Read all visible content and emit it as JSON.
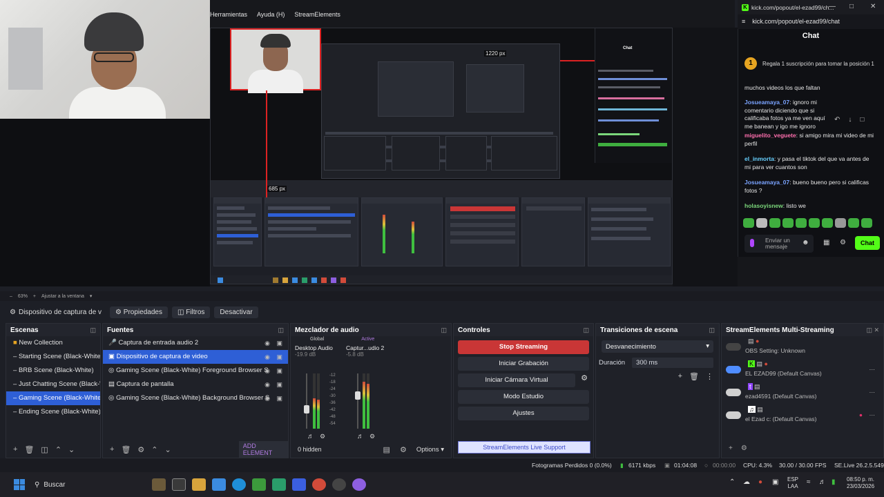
{
  "menu": [
    "Herramientas",
    "Ayuda (H)",
    "StreamElements"
  ],
  "preview_overlay": {
    "px_top": "1220 px",
    "px_left": "685 px"
  },
  "chat_window": {
    "title": "kick.com/popout/el-ezad99/ch...",
    "url": "kick.com/popout/el-ezad99/chat",
    "heading": "Chat",
    "banner": "Regala 1 suscripción para tomar la posición 1",
    "banner_badge": "1",
    "messages": [
      {
        "user": "",
        "text": "muchos videos los que faltan",
        "color": "#e6e6e6"
      },
      {
        "user": "Josueamaya_07",
        "text": ": ignoro mi comentario diciendo que si calificaba fotos ya me ven aquí me banean y igo me ignoro",
        "color": "#7aa3ff"
      },
      {
        "user": "miguelito_veguete",
        "text": ": si amigo mira mi video de mi perfil",
        "color": "#ff6fae"
      },
      {
        "user": "el_inmorta",
        "text": ": y pasa el tiktok del que va antes de mi para ver cuantos son",
        "color": "#67d0ff"
      },
      {
        "user": "Josueamaya_07",
        "text": ": bueno bueno pero si calificas fotos ?",
        "color": "#7aa3ff"
      },
      {
        "user": "holasoyisnew",
        "text": ": listo we",
        "color": "#7bd77b"
      }
    ],
    "input_placeholder": "Enviar un mensaje",
    "send_label": "Chat"
  },
  "zoom": {
    "level": "63%",
    "fit_label": "Ajustar a la ventana"
  },
  "source_toolbar": {
    "selected_source": "Dispositivo de captura de v",
    "properties": "Propiedades",
    "filters": "Filtros",
    "deactivate": "Desactivar"
  },
  "docks": {
    "scenes": {
      "title": "Escenas",
      "items": [
        "New Collection",
        "Starting Scene (Black-White)",
        "BRB Scene (Black-White)",
        "Just Chatting Scene (Black-Whit",
        "Gaming Scene (Black-White)",
        "Ending Scene (Black-White)"
      ],
      "selected_index": 4
    },
    "sources": {
      "title": "Fuentes",
      "items": [
        "Captura de entrada audio 2",
        "Dispositivo de captura de video",
        "Gaming Scene (Black-White) Foreground Browser S",
        "Captura de pantalla",
        "Gaming Scene (Black-White) Background Browser S"
      ],
      "selected_index": 1,
      "add_element": "ADD ELEMENT"
    },
    "mixer": {
      "title": "Mezclador de audio",
      "tab_global": "Global",
      "tab_active": "Active",
      "channels": [
        {
          "name": "Desktop Audio",
          "db": "-19.9 dB",
          "level": 0.55,
          "fader": 0.35
        },
        {
          "name": "Captur...udio 2",
          "db": "-5.8 dB",
          "level": 0.85,
          "fader": 0.6
        }
      ],
      "scale": [
        "-12",
        "-18",
        "-24",
        "-30",
        "-36",
        "-42",
        "-48",
        "-54"
      ],
      "hidden": "0 hidden",
      "options": "Options"
    },
    "controls": {
      "title": "Controles",
      "buttons": [
        "Stop Streaming",
        "Iniciar Grabación",
        "Iniciar Cámara Virtual",
        "Modo Estudio",
        "Ajustes"
      ],
      "se_support": "StreamElements Live Support"
    },
    "transitions": {
      "title": "Transiciones de escena",
      "selected": "Desvanecimiento",
      "duration_label": "Duración",
      "duration_value": "300 ms"
    },
    "multistream": {
      "title": "StreamElements Multi-Streaming",
      "rows": [
        {
          "label": "OBS Setting: Unknown",
          "on": false
        },
        {
          "label": "EL EZAD99 (Default Canvas)",
          "on": true
        },
        {
          "label": "ezad4591 (Default Canvas)",
          "on": false
        },
        {
          "label": "el Ezad c: (Default Canvas)",
          "on": false
        }
      ]
    }
  },
  "status": {
    "dropped": "Fotogramas Perdidos 0 (0.0%)",
    "kbps": "6171 kbps",
    "stream_time": "01:04:08",
    "rec_time": "00:00:00",
    "cpu": "CPU: 4.3%",
    "fps": "30.00 / 30.00 FPS",
    "version": "SE.Live 26.2.5.549"
  },
  "taskbar": {
    "search": "Buscar",
    "lang": "ESP",
    "lang2": "LAA",
    "time": "08:50 p. m.",
    "date": "23/03/2026"
  },
  "colors": {
    "accent": "#2e5fd6",
    "kick_green": "#53fc18",
    "stop_red": "#c93636"
  }
}
